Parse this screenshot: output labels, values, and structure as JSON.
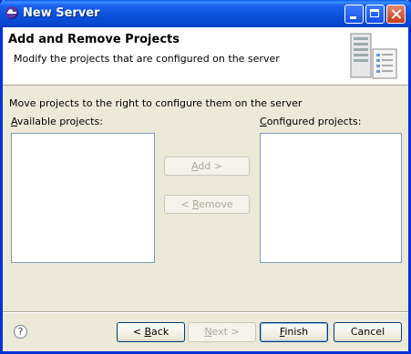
{
  "window": {
    "title": "New Server"
  },
  "banner": {
    "title": "Add and Remove Projects",
    "description": "Modify the projects that are configured on the server",
    "icon": "server-wizard-icon"
  },
  "content": {
    "instruction": "Move projects to the right to configure them on the server",
    "available_label_mnemonic": "A",
    "available_label_rest": "vailable projects:",
    "configured_label_mnemonic": "C",
    "configured_label_rest": "onfigured projects:",
    "available_items": [],
    "configured_items": []
  },
  "buttons": {
    "add": {
      "mnemonic": "A",
      "rest": "dd >",
      "enabled": false
    },
    "remove": {
      "prefix": "< ",
      "mnemonic": "R",
      "rest": "emove",
      "enabled": false
    },
    "back": {
      "prefix": "< ",
      "mnemonic": "B",
      "rest": "ack",
      "enabled": true
    },
    "next": {
      "mnemonic": "N",
      "rest": "ext >",
      "enabled": false
    },
    "finish": {
      "mnemonic": "F",
      "rest": "inish",
      "enabled": true
    },
    "cancel": {
      "label": "Cancel",
      "enabled": true
    }
  },
  "help": {
    "glyph": "?"
  },
  "colors": {
    "titlebar": "#0a4fd8",
    "dialog_bg": "#ece9d8",
    "list_border": "#7f9db9"
  }
}
